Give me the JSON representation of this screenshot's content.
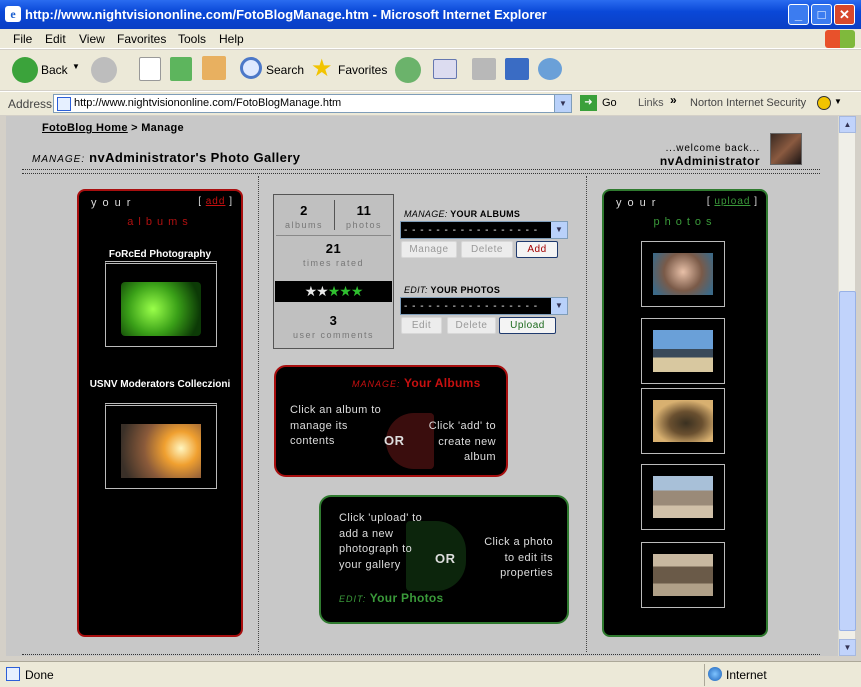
{
  "window": {
    "title": "http://www.nightvisiononline.com/FotoBlogManage.htm - Microsoft Internet Explorer"
  },
  "menu": [
    "File",
    "Edit",
    "View",
    "Favorites",
    "Tools",
    "Help"
  ],
  "toolbar": {
    "back": "Back",
    "search": "Search",
    "favorites": "Favorites"
  },
  "addressbar": {
    "label": "Address",
    "url": "http://www.nightvisiononline.com/FotoBlogManage.htm",
    "go": "Go",
    "links": "Links",
    "norton": "Norton Internet Security"
  },
  "page": {
    "breadcrumb": {
      "home": "FotoBlog Home",
      "sep": " > ",
      "current": "Manage"
    },
    "title_prefix": "MANAGE:",
    "title": "nvAdministrator's Photo Gallery",
    "welcome": "...welcome back...",
    "username": "nvAdministrator",
    "albums_panel": {
      "header": "your",
      "link_open": "[ ",
      "link": "add",
      "link_close": " ]",
      "sub": "albums",
      "albums": [
        {
          "name": "FoRcEd Photography"
        },
        {
          "name": "USNV Moderators Colleczioni"
        }
      ]
    },
    "photos_panel": {
      "header": "your",
      "link_open": "[ ",
      "link": "upload",
      "link_close": " ]",
      "sub": "photos"
    },
    "stats": {
      "albums": "2",
      "albums_label": "albums",
      "photos": "11",
      "photos_label": "photos",
      "rated": "21",
      "rated_label": "times rated",
      "comments": "3",
      "comments_label": "user comments",
      "rating_stars": 2,
      "rating_max": 5
    },
    "manage_albums": {
      "prefix": "MANAGE:",
      "label": "YOUR ALBUMS",
      "select": "- - - - - - - - - - - - - - - - -",
      "btn_manage": "Manage",
      "btn_delete": "Delete",
      "btn_add": "Add"
    },
    "edit_photos": {
      "prefix": "EDIT:",
      "label": "YOUR PHOTOS",
      "select": "- - - - - - - - - - - - - - - - -",
      "btn_edit": "Edit",
      "btn_delete": "Delete",
      "btn_upload": "Upload"
    },
    "info_albums": {
      "prefix": "MANAGE:",
      "title": "Your Albums",
      "left": "Click an album to manage its contents",
      "or": "OR",
      "right": "Click 'add' to create new album"
    },
    "info_photos": {
      "prefix": "EDIT:",
      "title": "Your Photos",
      "left": "Click 'upload' to add a new photograph to your gallery",
      "or": "OR",
      "right": "Click a photo to edit its properties"
    }
  },
  "status": {
    "left": "Done",
    "zone": "Internet"
  },
  "colors": {
    "red": "#a80f0f",
    "green": "#2f7a2f",
    "title_blue": "#0a48d8"
  }
}
